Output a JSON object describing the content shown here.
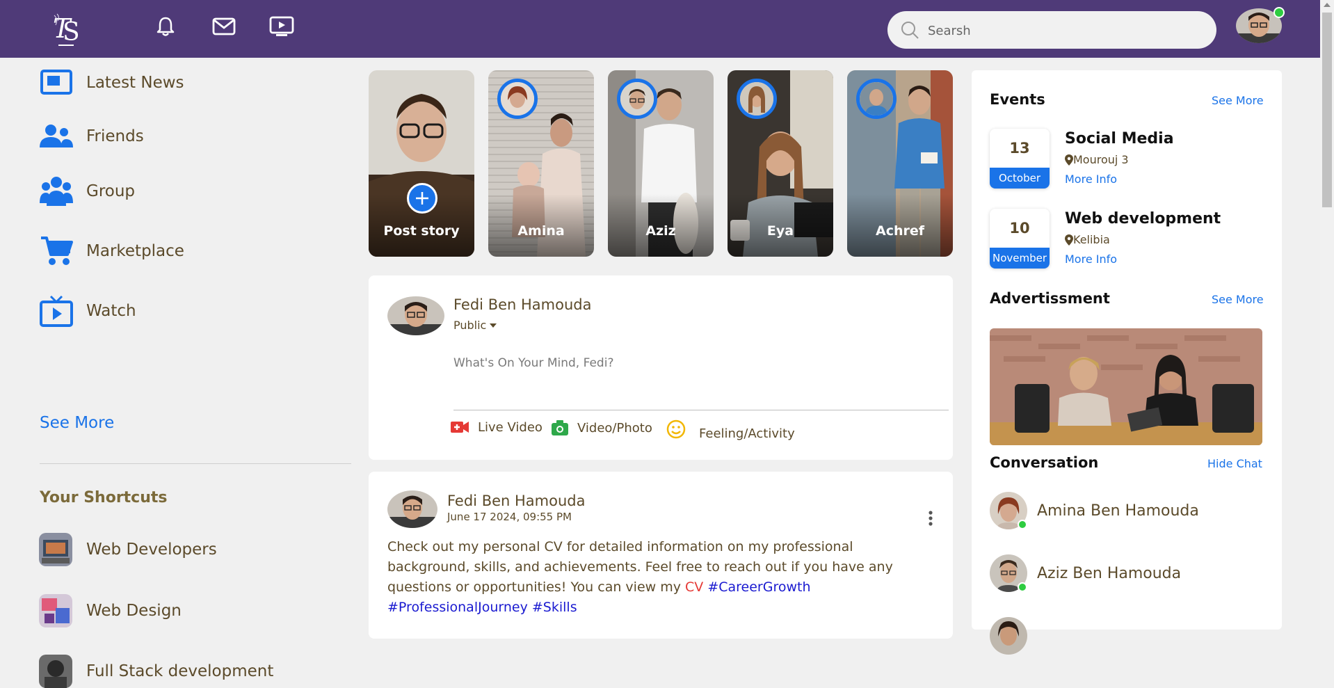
{
  "colors": {
    "topbar": "#4f3a78",
    "accent": "#1a73e8",
    "text": "#5b4a2a",
    "cv": "#e53935",
    "hashtag": "#1a1ad0",
    "online": "#2ecc40"
  },
  "header": {
    "search_placeholder": "Searsh",
    "icons": [
      "bell-icon",
      "mail-icon",
      "video-play-icon"
    ]
  },
  "sidebar": {
    "items": [
      {
        "label": "Latest News",
        "icon": "news-icon"
      },
      {
        "label": "Friends",
        "icon": "friends-icon"
      },
      {
        "label": "Group",
        "icon": "group-icon"
      },
      {
        "label": "Marketplace",
        "icon": "cart-icon"
      },
      {
        "label": "Watch",
        "icon": "tv-play-icon"
      }
    ],
    "see_more": "See More",
    "shortcuts_title": "Your Shortcuts",
    "shortcuts": [
      {
        "label": "Web Developers"
      },
      {
        "label": "Web Design"
      },
      {
        "label": "Full Stack development"
      }
    ]
  },
  "stories": [
    {
      "label": "Post story"
    },
    {
      "label": "Amina"
    },
    {
      "label": "Aziz"
    },
    {
      "label": "Eya"
    },
    {
      "label": "Achref"
    }
  ],
  "create_post": {
    "user_name": "Fedi Ben Hamouda",
    "privacy": "Public",
    "placeholder": "What's On Your Mind, Fedi?",
    "actions": [
      {
        "label": "Live Video",
        "icon": "live-video-icon"
      },
      {
        "label": "Video/Photo",
        "icon": "camera-icon"
      },
      {
        "label": "Feeling/Activity",
        "icon": "smiley-icon"
      }
    ]
  },
  "post": {
    "author": "Fedi Ben Hamouda",
    "date": "June 17 2024, 09:55 PM",
    "text_main": "Check out my personal CV for detailed information on my professional background, skills, and achievements. Feel free to reach out if you have any questions or opportunities! You can view my ",
    "cv_link": "CV",
    "tag1": "#CareerGrowth",
    "tag2": "#ProfessionalJourney",
    "tag3": "#Skills"
  },
  "right": {
    "events_title": "Events",
    "see_more": "See More",
    "events": [
      {
        "day": "13",
        "month": "October",
        "title": "Social Media",
        "location": "Mourouj 3",
        "more": "More Info"
      },
      {
        "day": "10",
        "month": "November",
        "title": "Web development",
        "location": "Kelibia",
        "more": "More Info"
      }
    ],
    "ads_title": "Advertissment",
    "conversation_title": "Conversation",
    "hide_chat": "Hide Chat",
    "contacts": [
      {
        "name": "Amina Ben Hamouda"
      },
      {
        "name": "Aziz Ben Hamouda"
      }
    ]
  }
}
